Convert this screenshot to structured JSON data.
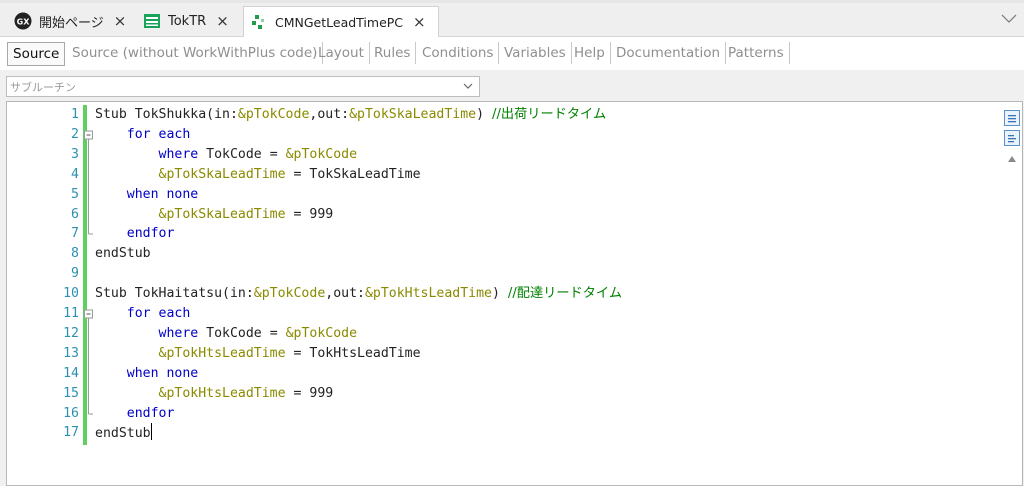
{
  "tabs": [
    {
      "label": "開始ページ",
      "icon": "genexus-logo-icon",
      "close": "×"
    },
    {
      "label": "TokTR",
      "icon": "transaction-icon",
      "close": "×"
    },
    {
      "label": "CMNGetLeadTimePC",
      "icon": "procedure-icon",
      "close": "×"
    }
  ],
  "subtabs": [
    "Source",
    "Source (without WorkWithPlus code)",
    "Layout",
    "Rules",
    "Conditions",
    "Variables",
    "Help",
    "Documentation",
    "Patterns"
  ],
  "subroutine_combo": {
    "placeholder": "サブルーチン"
  },
  "code_lines": [
    {
      "n": "1",
      "html": "Stub TokShukka(in:<span class='var'>&amp;pTokCode</span>,out:<span class='var'>&amp;pTokSkaLeadTime</span>) <span class='cm'>//出荷リードタイム</span>"
    },
    {
      "n": "2",
      "html": "    <span class='kw'>for each</span>"
    },
    {
      "n": "3",
      "html": "        <span class='kw'>where</span> TokCode = <span class='var'>&amp;pTokCode</span>"
    },
    {
      "n": "4",
      "html": "        <span class='var'>&amp;pTokSkaLeadTime</span> = TokSkaLeadTime"
    },
    {
      "n": "5",
      "html": "    <span class='kw'>when none</span>"
    },
    {
      "n": "6",
      "html": "        <span class='var'>&amp;pTokSkaLeadTime</span> = 999"
    },
    {
      "n": "7",
      "html": "    <span class='kw'>endfor</span>"
    },
    {
      "n": "8",
      "html": "endStub"
    },
    {
      "n": "9",
      "html": ""
    },
    {
      "n": "10",
      "html": "Stub TokHaitatsu(in:<span class='var'>&amp;pTokCode</span>,out:<span class='var'>&amp;pTokHtsLeadTime</span>) <span class='cm'>//配達リードタイム</span>"
    },
    {
      "n": "11",
      "html": "    <span class='kw'>for each</span>"
    },
    {
      "n": "12",
      "html": "        <span class='kw'>where</span> TokCode = <span class='var'>&amp;pTokCode</span>"
    },
    {
      "n": "13",
      "html": "        <span class='var'>&amp;pTokHtsLeadTime</span> = TokHtsLeadTime"
    },
    {
      "n": "14",
      "html": "    <span class='kw'>when none</span>"
    },
    {
      "n": "15",
      "html": "        <span class='var'>&amp;pTokHtsLeadTime</span> = 999"
    },
    {
      "n": "16",
      "html": "    <span class='kw'>endfor</span>"
    },
    {
      "n": "17",
      "html": "endStub"
    }
  ],
  "colors": {
    "keyword": "#0000c8",
    "variable": "#8a8a00",
    "comment": "#008000",
    "line_number": "#2b91af",
    "change_bar": "#5fd05f"
  }
}
